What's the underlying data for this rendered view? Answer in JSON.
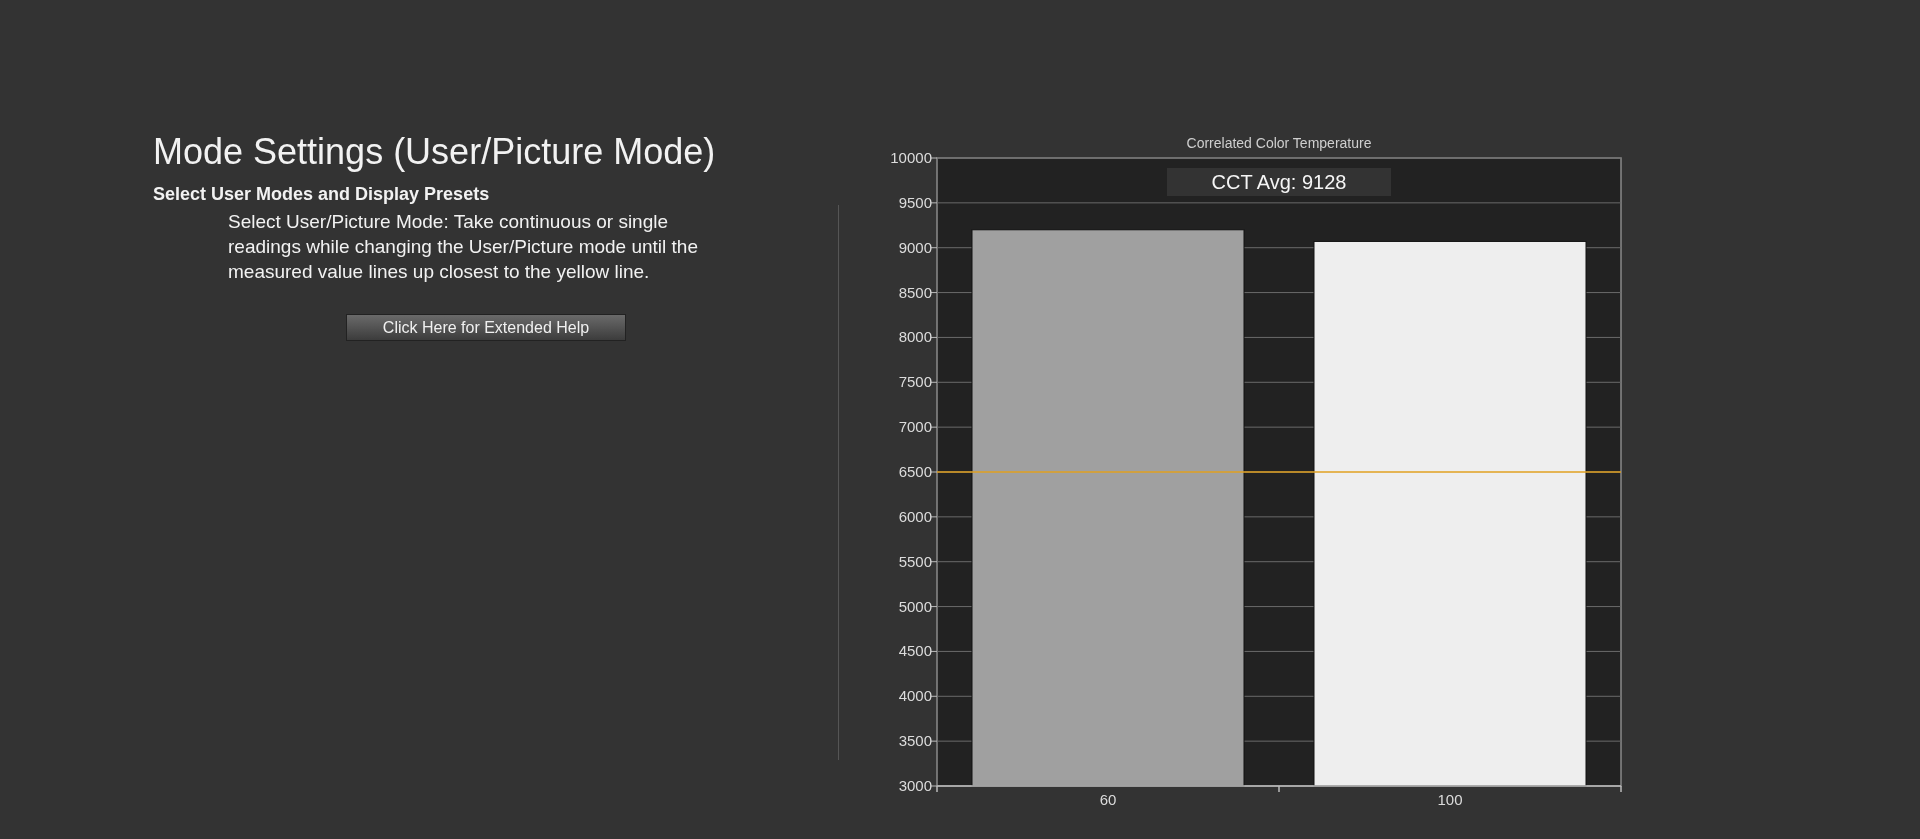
{
  "heading": "Mode Settings (User/Picture Mode)",
  "subheading": "Select User Modes and Display Presets",
  "instructions": "Select User/Picture Mode: Take continuous or single readings while changing the User/Picture mode until the measured value lines up closest to the yellow line.",
  "help_button": {
    "label": "Click Here for Extended Help"
  },
  "chart": {
    "chart_data": {
      "type": "bar",
      "title": "Correlated Color Temperature",
      "categories": [
        "60",
        "100"
      ],
      "series": [
        {
          "color": "#a0a0a0",
          "values": [
            9200,
            null
          ]
        },
        {
          "color": "#eeeeee",
          "values": [
            null,
            9070
          ]
        }
      ],
      "ylim": [
        3000,
        10000
      ],
      "yticks": [
        3000,
        3500,
        4000,
        4500,
        5000,
        5500,
        6000,
        6500,
        7000,
        7500,
        8000,
        8500,
        9000,
        9500,
        10000
      ],
      "grid": true,
      "ref_lines": [
        {
          "axis": "y",
          "value": 6500,
          "color": "#e0a020"
        }
      ],
      "annotations": [
        {
          "text": "CCT Avg: 9128"
        }
      ]
    }
  }
}
